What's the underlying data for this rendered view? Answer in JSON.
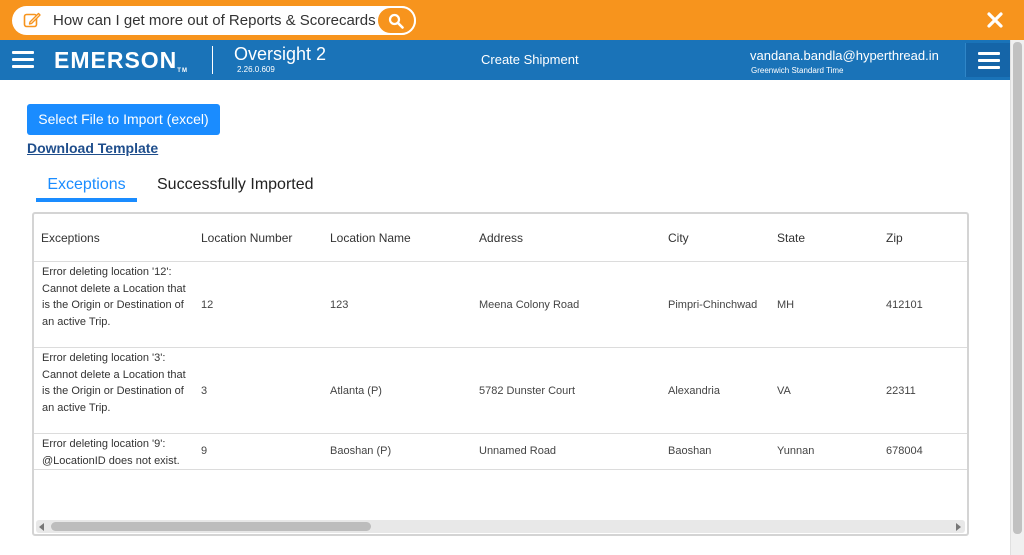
{
  "topbar": {
    "question": "How can I get more out of Reports & Scorecards?",
    "edit_icon": "edit-icon",
    "search_icon": "search-icon",
    "close_icon": "close-icon",
    "color": "#f7941d"
  },
  "header": {
    "brand": "EMERSON",
    "app_name": "Oversight 2",
    "version": "2.26.0.609",
    "page_title": "Create Shipment",
    "user_email": "vandana.bandla@hyperthread.in",
    "timezone": "Greenwich Standard Time",
    "color": "#1a73b8"
  },
  "actions": {
    "import_label": "Select File to Import (excel)",
    "download_label": "Download Template"
  },
  "tabs": [
    {
      "label": "Exceptions",
      "active": true
    },
    {
      "label": "Successfully Imported",
      "active": false
    }
  ],
  "table": {
    "columns": [
      "Exceptions",
      "Location Number",
      "Location Name",
      "Address",
      "City",
      "State",
      "Zip"
    ],
    "rows": [
      {
        "exception": "Error deleting location '12': Cannot delete a Location that is the Origin or Destination of an active Trip.",
        "location_number": "12",
        "location_name": "123",
        "address": "Meena Colony Road",
        "city": "Pimpri-Chinchwad",
        "state": "MH",
        "zip": "412101"
      },
      {
        "exception": "Error deleting location '3': Cannot delete a Location that is the Origin or Destination of an active Trip.",
        "location_number": "3",
        "location_name": "Atlanta (P)",
        "address": "5782 Dunster Court",
        "city": "Alexandria",
        "state": "VA",
        "zip": "22311"
      },
      {
        "exception": "Error deleting location '9': @LocationID does not exist.",
        "location_number": "9",
        "location_name": "Baoshan (P)",
        "address": "Unnamed Road",
        "city": "Baoshan",
        "state": "Yunnan",
        "zip": "678004"
      }
    ]
  }
}
